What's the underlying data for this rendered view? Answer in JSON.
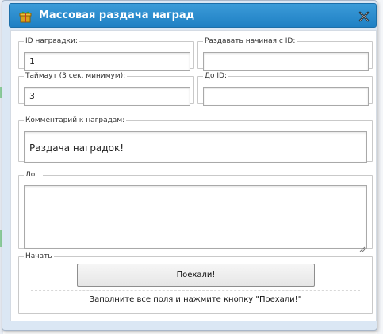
{
  "window": {
    "title": "Массовая раздача наград",
    "icons": {
      "app": "gift-icon",
      "close": "close-icon"
    },
    "colors": {
      "titlebar": "#2a8ccf",
      "panel_bg": "#dbe7f4"
    }
  },
  "fields": {
    "reward_id": {
      "label": "ID награадки:",
      "value": "1"
    },
    "start_id": {
      "label": "Раздавать начиная с ID:",
      "value": ""
    },
    "timeout": {
      "label": "Таймаут (3 сек. минимум):",
      "value": "3"
    },
    "end_id": {
      "label": "До ID:",
      "value": ""
    },
    "comment": {
      "label": "Комментарий к наградам:",
      "value": "Раздача наградок!"
    },
    "log": {
      "label": "Лог:",
      "value": ""
    }
  },
  "start": {
    "legend": "Начать",
    "button_label": "Поехали!",
    "hint": "Заполните все поля и нажмите кнопку \"Поехали!\""
  }
}
